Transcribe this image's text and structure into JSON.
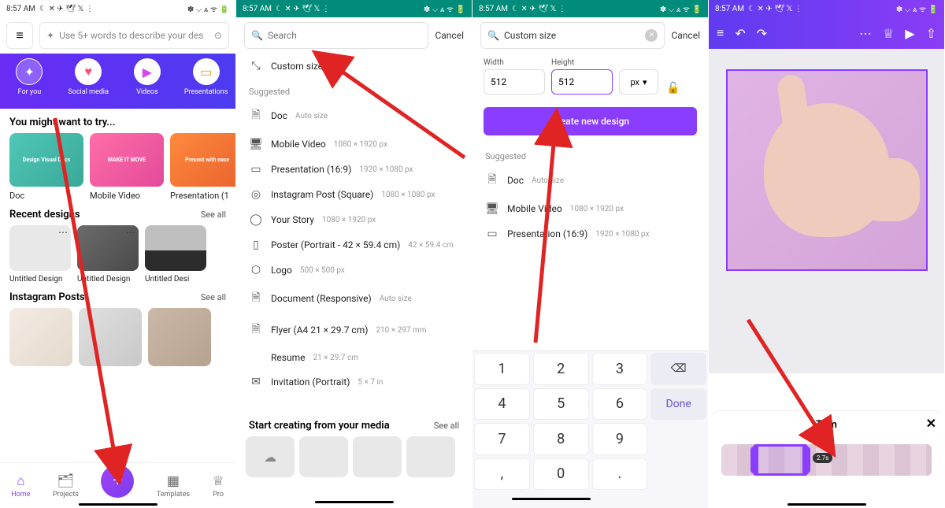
{
  "status": {
    "time": "8:57 AM",
    "left_icons": "☾ ✕ ✈ 🕊 𝕏 ⋮",
    "right_icons": "✽ ⌵ ⩓ ᯤ 🔋"
  },
  "panel1": {
    "search_placeholder": "Use 5+ words to describe your des",
    "categories": [
      {
        "label": "For you",
        "icon": "✦",
        "color": "#4a6cf7"
      },
      {
        "label": "Social media",
        "icon": "♥",
        "color": "#ff4d6d"
      },
      {
        "label": "Videos",
        "icon": "▶",
        "color": "#d946ef"
      },
      {
        "label": "Presentations",
        "icon": "▭",
        "color": "#f59e0b"
      }
    ],
    "try_heading": "You might want to try...",
    "try_cards": [
      {
        "label": "Doc",
        "thumb_text": "Design Visual Docs"
      },
      {
        "label": "Mobile Video",
        "thumb_text": "MAKE IT MOVE"
      },
      {
        "label": "Presentation (1",
        "thumb_text": "Present with ease"
      }
    ],
    "recent_heading": "Recent designs",
    "see_all": "See all",
    "recent": [
      {
        "label": "Untitled Design"
      },
      {
        "label": "Untitled Design"
      },
      {
        "label": "Untitled Desi"
      }
    ],
    "insta_heading": "Instagram Posts",
    "bottom_nav": [
      {
        "label": "Home",
        "icon": "⌂"
      },
      {
        "label": "Projects",
        "icon": "🗂"
      },
      {
        "label": "",
        "icon": "+"
      },
      {
        "label": "Templates",
        "icon": "▦"
      },
      {
        "label": "Pro",
        "icon": "♕"
      }
    ]
  },
  "panel2": {
    "search_placeholder": "Search",
    "cancel": "Cancel",
    "custom_size": "Custom size",
    "suggested": "Suggested",
    "items": [
      {
        "icon": "🗎",
        "label": "Doc",
        "dim": "Auto size"
      },
      {
        "icon": "🖥",
        "label": "Mobile Video",
        "dim": "1080 × 1920 px"
      },
      {
        "icon": "▭",
        "label": "Presentation (16:9)",
        "dim": "1920 × 1080 px"
      },
      {
        "icon": "◎",
        "label": "Instagram Post (Square)",
        "dim": "1080 × 1080 px"
      },
      {
        "icon": "◯",
        "label": "Your Story",
        "dim": "1080 × 1920 px"
      },
      {
        "icon": "▯",
        "label": "Poster (Portrait - 42 × 59.4 cm)",
        "dim": "42 × 59.4 cm"
      },
      {
        "icon": "⬡",
        "label": "Logo",
        "dim": "500 × 500 px"
      },
      {
        "icon": "🗎",
        "label": "Document (Responsive)",
        "dim": "Auto size"
      },
      {
        "icon": "🗎",
        "label": "Flyer (A4 21 × 29.7 cm)",
        "dim": "210 × 297 mm"
      },
      {
        "icon": "",
        "label": "Resume",
        "dim": "21 × 29.7 cm"
      },
      {
        "icon": "✉",
        "label": "Invitation (Portrait)",
        "dim": "5 × 7 in"
      }
    ],
    "media_heading": "Start creating from your media"
  },
  "panel3": {
    "search_value": "Custom size",
    "cancel": "Cancel",
    "width_label": "Width",
    "height_label": "Height",
    "width_value": "512",
    "height_value": "512",
    "unit": "px",
    "create_label": "Create new design",
    "suggested": "Suggested",
    "items": [
      {
        "icon": "🗎",
        "label": "Doc",
        "dim": "Auto size"
      },
      {
        "icon": "🖥",
        "label": "Mobile Video",
        "dim": "1080 × 1920 px"
      },
      {
        "icon": "▭",
        "label": "Presentation (16:9)",
        "dim": "1920 × 1080 px"
      }
    ],
    "keypad": {
      "keys": [
        [
          "1",
          "2",
          "3",
          "⌫"
        ],
        [
          "4",
          "5",
          "6",
          "Done"
        ],
        [
          "7",
          "8",
          "9",
          ""
        ],
        [
          ",",
          "0",
          ".",
          ""
        ]
      ]
    }
  },
  "panel4": {
    "trim_label": "Trim",
    "duration_badge": "2.7s"
  }
}
